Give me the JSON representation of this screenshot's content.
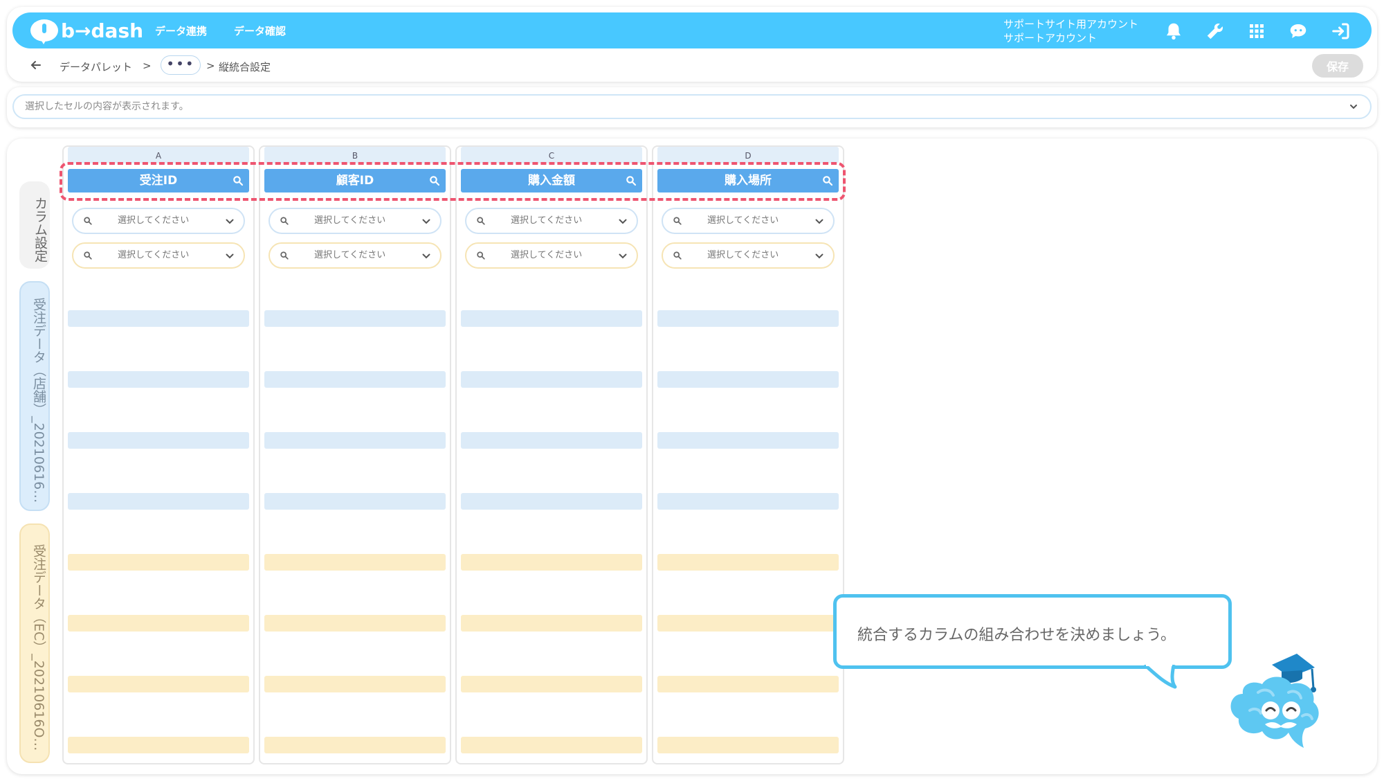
{
  "header": {
    "logo_text": "b→dash",
    "nav": [
      "データ連携",
      "データ確認"
    ],
    "account_line1": "サポートサイト用アカウント",
    "account_line2": "サポートアカウント",
    "icons": [
      "bell-icon",
      "wrench-icon",
      "grid-icon",
      "chat-icon",
      "logout-icon"
    ],
    "color": "#48c8ff"
  },
  "breadcrumb": {
    "back_icon": "arrow-left-icon",
    "item1": "データパレット",
    "sep": ">",
    "more": "•••",
    "current": "縦統合設定"
  },
  "toolbar": {
    "save_label": "保存"
  },
  "cell_bar": {
    "placeholder": "選択したセルの内容が表示されます。"
  },
  "tabs": {
    "column_settings": "カラム設定",
    "source1": "受注データ（店舗）_20210616…",
    "source2": "受注データ（EC）_20210616O…"
  },
  "columns": [
    {
      "letter": "A",
      "name": "受注ID"
    },
    {
      "letter": "B",
      "name": "顧客ID"
    },
    {
      "letter": "C",
      "name": "購入金額"
    },
    {
      "letter": "D",
      "name": "購入場所"
    }
  ],
  "select_placeholder": "選択してください",
  "tooltip": {
    "text": "統合するカラムの組み合わせを決めましょう。"
  },
  "colors": {
    "column_header": "#5aa9ec",
    "blue_row": "#dcebf8",
    "yellow_row": "#fcedc6",
    "highlight": "#ee5570"
  }
}
